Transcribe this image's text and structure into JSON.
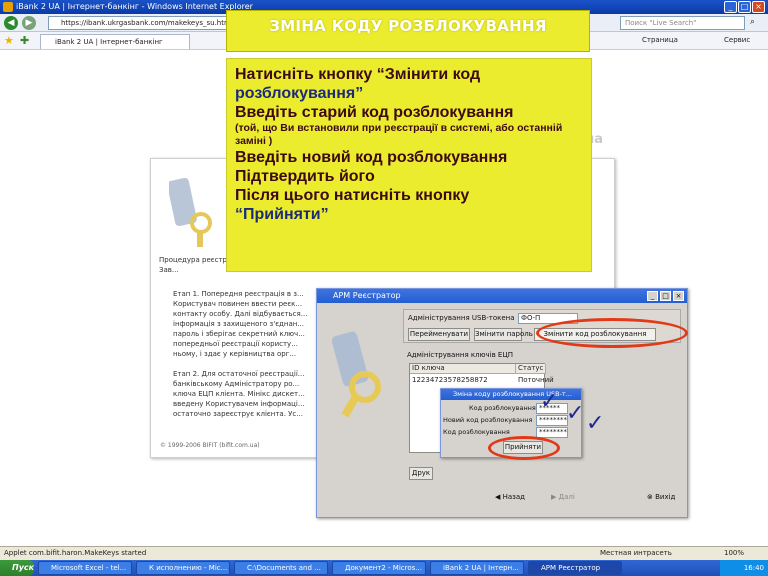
{
  "browser": {
    "window_title": "iBank 2 UA | Інтернет-банкінг - Windows Internet Explorer",
    "url": "https://ibank.ukrgasbank.com/makekeys_su.html",
    "search_placeholder": "Поиск \"Live Search\"",
    "tab_title": "iBank 2 UA | Інтернет-банкінг",
    "tools": [
      "Страница",
      "Сервис"
    ]
  },
  "bank_page": {
    "logo": "iBank2.ua",
    "logo_sub": "Інтернет-банкінг",
    "intro": "Процедура реєстрації ... реєстрація в Зав...",
    "steps": [
      "Етап 1. Попередня реєстрація в з... Користувач повинен ввести реєк... контакту особу. Далі відбувається... інформація з захищеного з'єднан... пароль і зберігає секретний ключ... попередньої реєстрації користу... ньому, і здає у керівництва орг...",
      "Етап 2. Для остаточної реєстрації... банківському Адміністратору ро... ключа ЕЦП клієнта. Мінікс дискет... введену Користувачем інформаці... остаточно зареєструє клієнта. Ус..."
    ],
    "footer": "© 1999-2006 BIFIT (bifit.com.ua)"
  },
  "slide": {
    "title": "ЗМІНА КОДУ РОЗБЛОКУВАННЯ",
    "lines": [
      {
        "text": "Натисніть кнопку “Змінити код",
        "size": "big"
      },
      {
        "text": "розблокування”",
        "size": "big",
        "color": "blue"
      },
      {
        "text": "Введіть старий код розблокування",
        "size": "big"
      },
      {
        "text": "(той, що Ви встановили при реєстрації в системі, або останній заміні )",
        "size": "small"
      },
      {
        "text": "Введіть новий код розблокування",
        "size": "big"
      },
      {
        "text": "Підтвердить його",
        "size": "big"
      },
      {
        "text": "Після цього натисніть кнопку",
        "size": "big"
      },
      {
        "text": "“Прийняти”",
        "size": "big",
        "color": "blue"
      }
    ]
  },
  "registrar": {
    "title": "АРМ Реєстратор",
    "usb_group": "Адміністрування USB-токена",
    "token_value": "ФО-П",
    "buttons": [
      "Перейменувати",
      "Змінити пароль",
      "Змінити код розблокування"
    ],
    "key_group": "Адміністрування ключів ЕЦП",
    "columns": [
      "ID ключа",
      "Статус"
    ],
    "rows": [
      [
        "12234723578258872",
        "Поточний"
      ]
    ],
    "bottom_button": "Друк",
    "nav": [
      "Назад",
      "Далі",
      "Вихід"
    ]
  },
  "change_dialog": {
    "title": "Зміна коду розблокування USB-т...",
    "fields": [
      {
        "label": "Код розблокування",
        "value": "******"
      },
      {
        "label": "Новий код розблокування",
        "value": "**********"
      },
      {
        "label": "Код розблокування",
        "value": "**********"
      }
    ],
    "accept": "Прийняти"
  },
  "status_bar": {
    "left": "Applet com.bifit.haron.MakeKeys started",
    "zone": "Местная интрасеть",
    "zoom": "100%"
  },
  "taskbar": {
    "start": "Пуск",
    "items": [
      "Microsoft Excel - tel...",
      "К исполнению - Mic...",
      "C:\\Documents and ...",
      "Документ2 - Micros...",
      "iBank 2 UA | Інтерн...",
      "АРМ Реєстратор"
    ],
    "clock": "16:40"
  },
  "colors": {
    "slide_yellow": "#ecec2e",
    "highlight_oval": "#e03a18",
    "xp_blue": "#245ed1"
  }
}
